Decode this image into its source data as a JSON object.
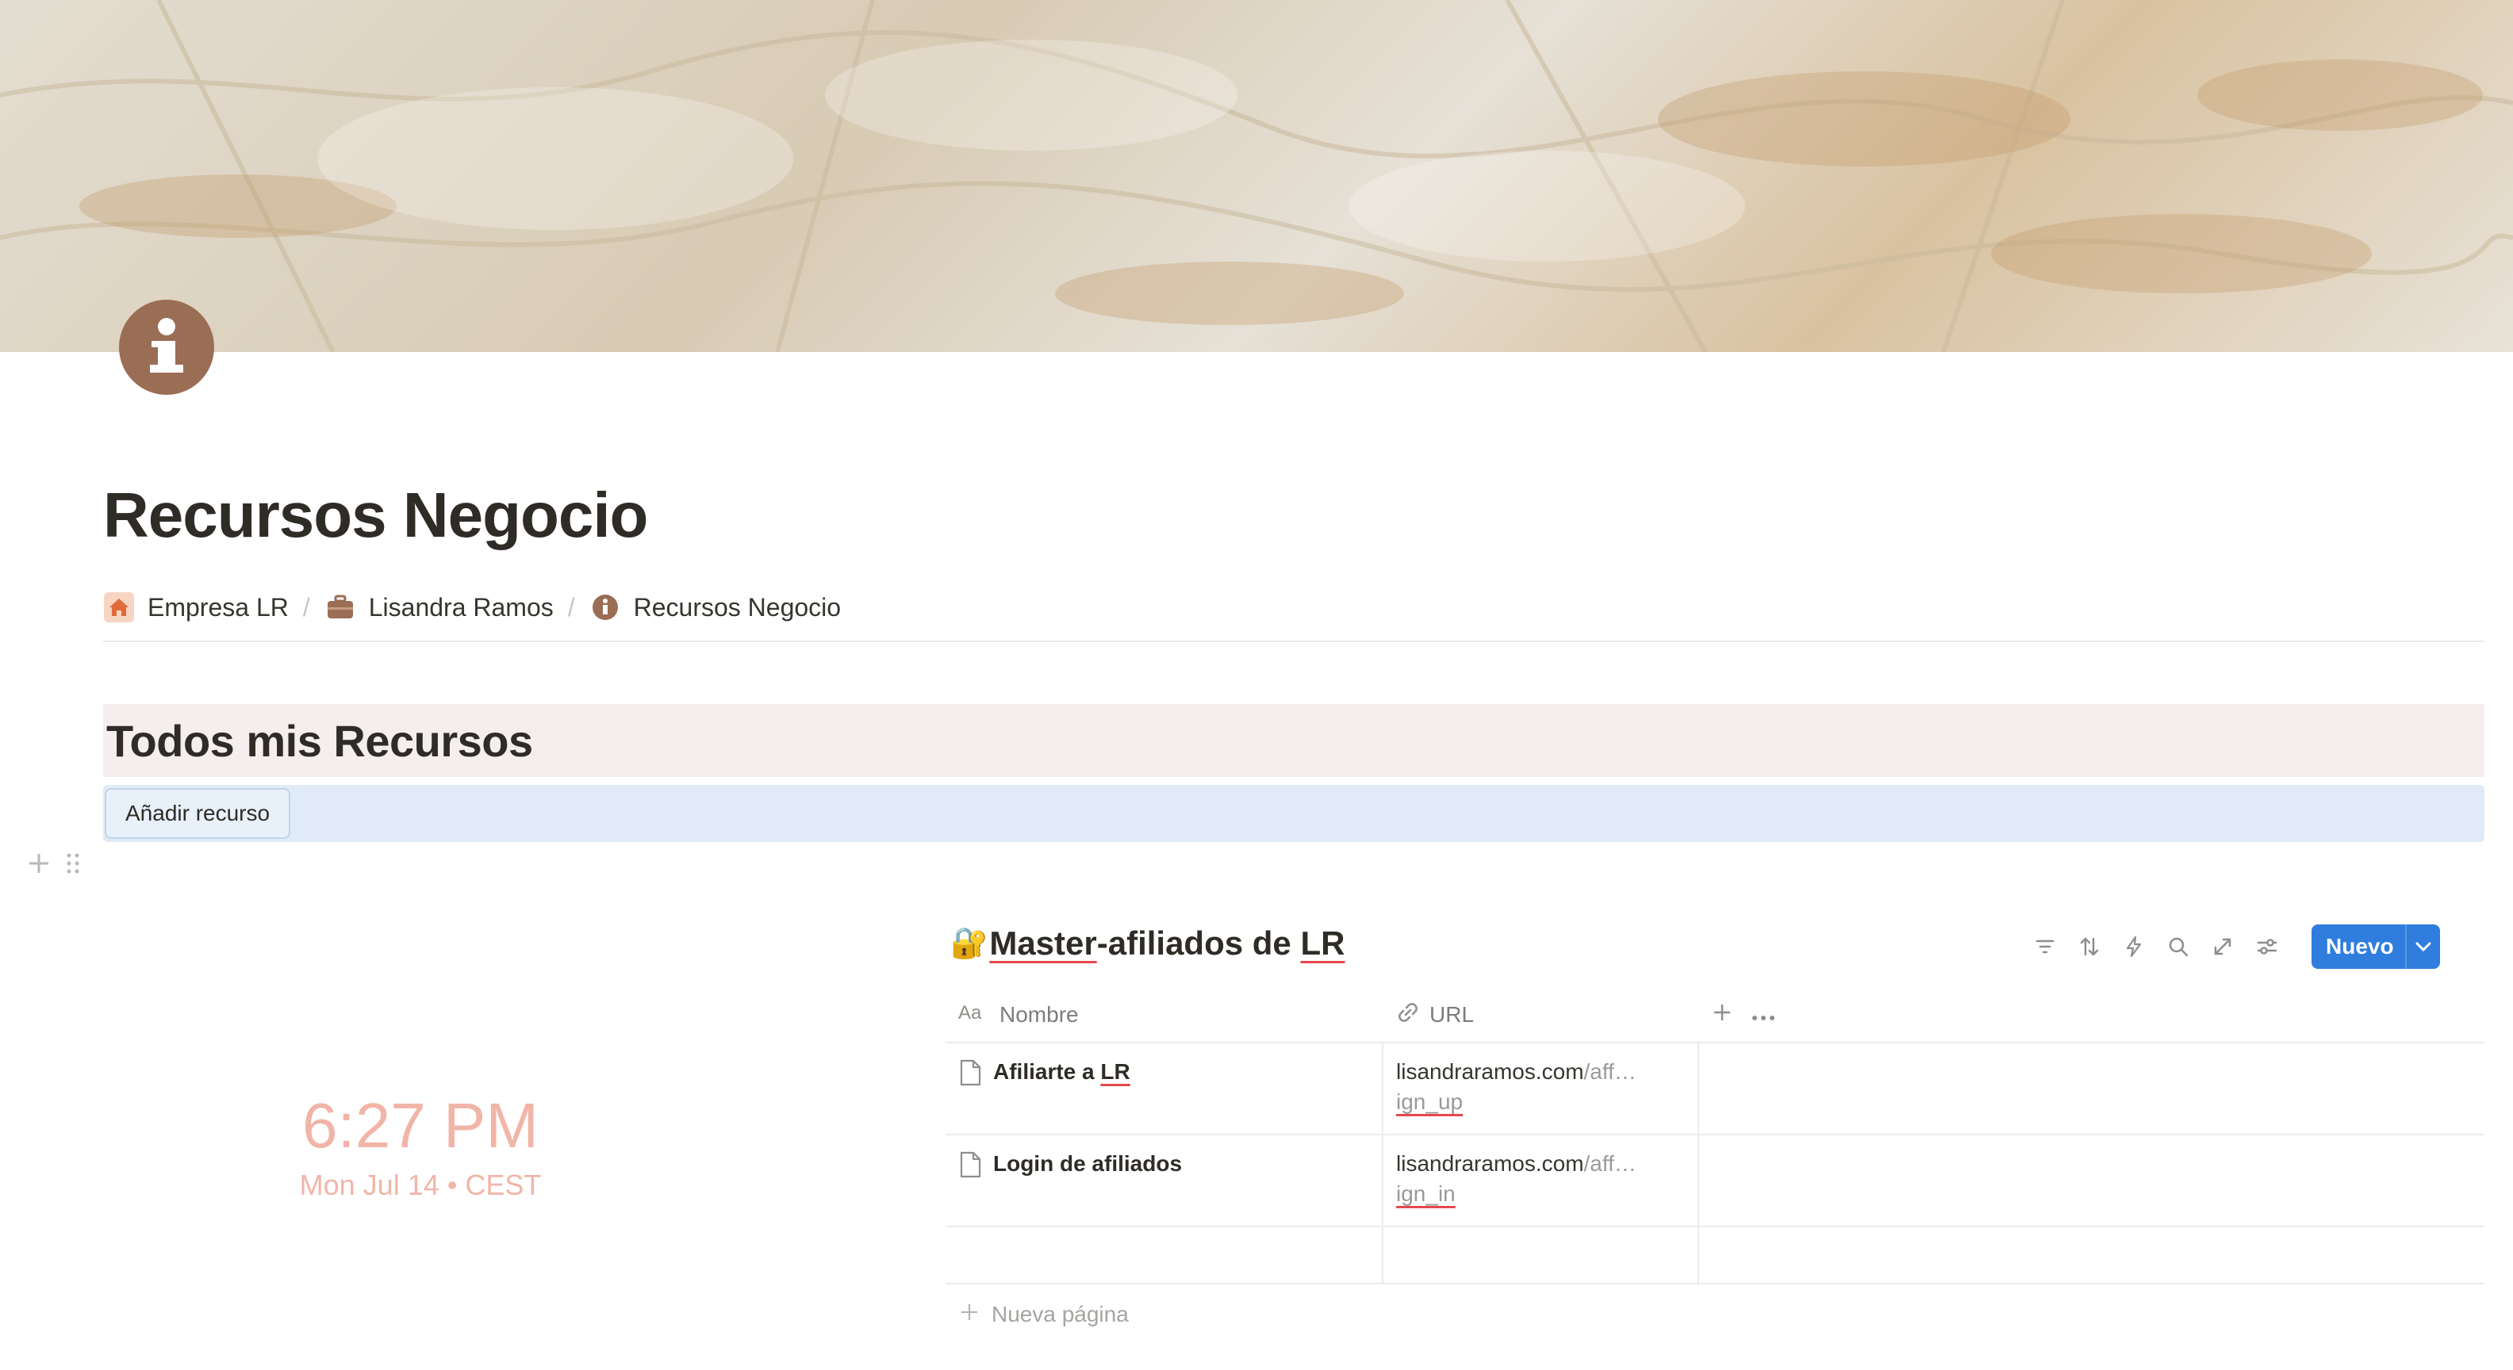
{
  "page": {
    "title": "Recursos Negocio"
  },
  "breadcrumb": [
    {
      "label": "Empresa LR",
      "icon": "home-icon"
    },
    {
      "label": "Lisandra Ramos",
      "icon": "briefcase-icon"
    },
    {
      "label": "Recursos Negocio",
      "icon": "info-icon"
    }
  ],
  "breadcrumb_separator": "/",
  "section": {
    "heading": "Todos mis Recursos",
    "button_label": "Añadir recurso"
  },
  "clock": {
    "time": "6:27 PM",
    "date": "Mon Jul 14 • CEST"
  },
  "database": {
    "title_emoji": "🔐",
    "title_part1": "Master",
    "title_part2": "-afiliados de ",
    "title_part3": "LR",
    "new_button": "Nuevo",
    "columns": [
      {
        "label": "Nombre",
        "icon": "text-property-icon"
      },
      {
        "label": "URL",
        "icon": "link-icon"
      }
    ],
    "rows": [
      {
        "name_a": "Afiliarte a ",
        "name_b": "LR",
        "url_main": "lisandraramos.com",
        "url_rest": "/aff…",
        "url_line2": "ign_up"
      },
      {
        "name_a": "Login de afiliados",
        "name_b": "",
        "url_main": "lisandraramos.com",
        "url_rest": "/aff…",
        "url_line2": "ign_in"
      }
    ],
    "new_page_label": "Nueva página"
  },
  "colors": {
    "accent": "#2f7ddd",
    "heading_bg": "#f4eeee",
    "button_bg": "#e1ebf8",
    "clock": "#f1b5a8",
    "page_icon": "#9a6d55"
  }
}
